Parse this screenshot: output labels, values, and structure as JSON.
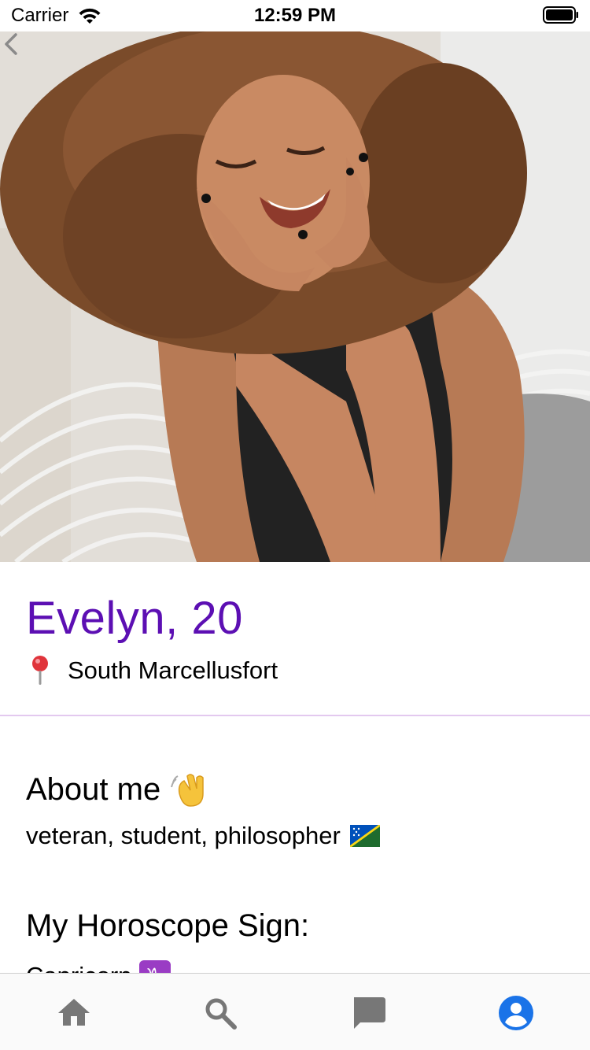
{
  "status_bar": {
    "carrier": "Carrier",
    "time": "12:59 PM"
  },
  "profile": {
    "name_age": "Evelyn, 20",
    "location": "South Marcellusfort"
  },
  "about": {
    "title": "About me",
    "text": "veteran, student, philosopher"
  },
  "horoscope": {
    "title": "My Horoscope Sign:",
    "value": "Capricorn",
    "symbol": "♑"
  },
  "tabs": [
    {
      "name": "home",
      "icon": "home-icon",
      "active": false
    },
    {
      "name": "search",
      "icon": "search-icon",
      "active": false
    },
    {
      "name": "messages",
      "icon": "chat-icon",
      "active": false
    },
    {
      "name": "profile",
      "icon": "account-circle-icon",
      "active": true
    }
  ],
  "colors": {
    "accent": "#5c0fb3",
    "active_tab": "#1a73e8",
    "inactive_tab": "#777777",
    "divider": "#e3c9ef"
  }
}
